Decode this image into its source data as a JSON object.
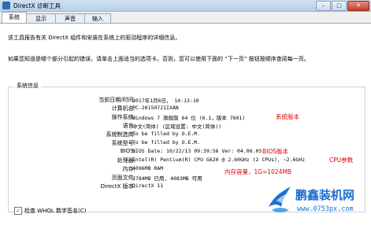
{
  "window": {
    "title": "DirectX 诊断工具",
    "minimize": "–",
    "maximize": "□",
    "close": "✕"
  },
  "tabs": [
    {
      "label": "系统",
      "active": true
    },
    {
      "label": "显示",
      "active": false
    },
    {
      "label": "声音",
      "active": false
    },
    {
      "label": "输入",
      "active": false
    }
  ],
  "intro": {
    "line1": "该工具报告有关 DirectX 组件和安装在系统上的驱动程序的详细信息。",
    "line2": "如果您知道是哪个部分引起的错误，请单击上面适当的选项卡。否则，您可以使用下面的 “下一页” 按钮按顺序查阅每一页。"
  },
  "system_info": {
    "title": "系统信息",
    "rows": [
      {
        "label": "当前日期/时间:",
        "value": "2017年1月6日， 14:13:10"
      },
      {
        "label": "计算机名:",
        "value": "PC-20150721IXAN"
      },
      {
        "label": "操作系统:",
        "value": "Windows 7 旗舰版 64 位 (6.1，版本 7601)"
      },
      {
        "label": "语言:",
        "value": "中文(简体) (区域设置: 中文(简体))"
      },
      {
        "label": "系统制造商:",
        "value": "To be filled by O.E.M."
      },
      {
        "label": "系统型号:",
        "value": "To be filled by O.E.M."
      },
      {
        "label": "BIOS:",
        "value": "BIOS Date: 10/22/13 09:39:56 Ver: 04.06.05"
      },
      {
        "label": "处理器:",
        "value": "Intel(R) Pentium(R) CPU G620 @ 2.60GHz (2 CPUs), ~2.6GHz"
      },
      {
        "label": "内存:",
        "value": "4096MB RAM"
      },
      {
        "label": "页面文件:",
        "value": "2784MB 已用, 4083MB 可用"
      },
      {
        "label": "DirectX 版本:",
        "value": "DirectX 11"
      }
    ]
  },
  "annotations": {
    "os_version": "系统版本",
    "bios_version": "BIOS版本",
    "cpu_params": "CPU参数",
    "memory_capacity": "内存容量，1G=1024MB"
  },
  "footer": {
    "checkbox_label": "检查 WHQL 数字签名(C)",
    "checked": true
  },
  "watermark": {
    "name": "鹏鑫装机网",
    "url": "www.0753px.com"
  },
  "colors": {
    "annotation": "#e00000",
    "watermark": "#1d6fd1"
  }
}
